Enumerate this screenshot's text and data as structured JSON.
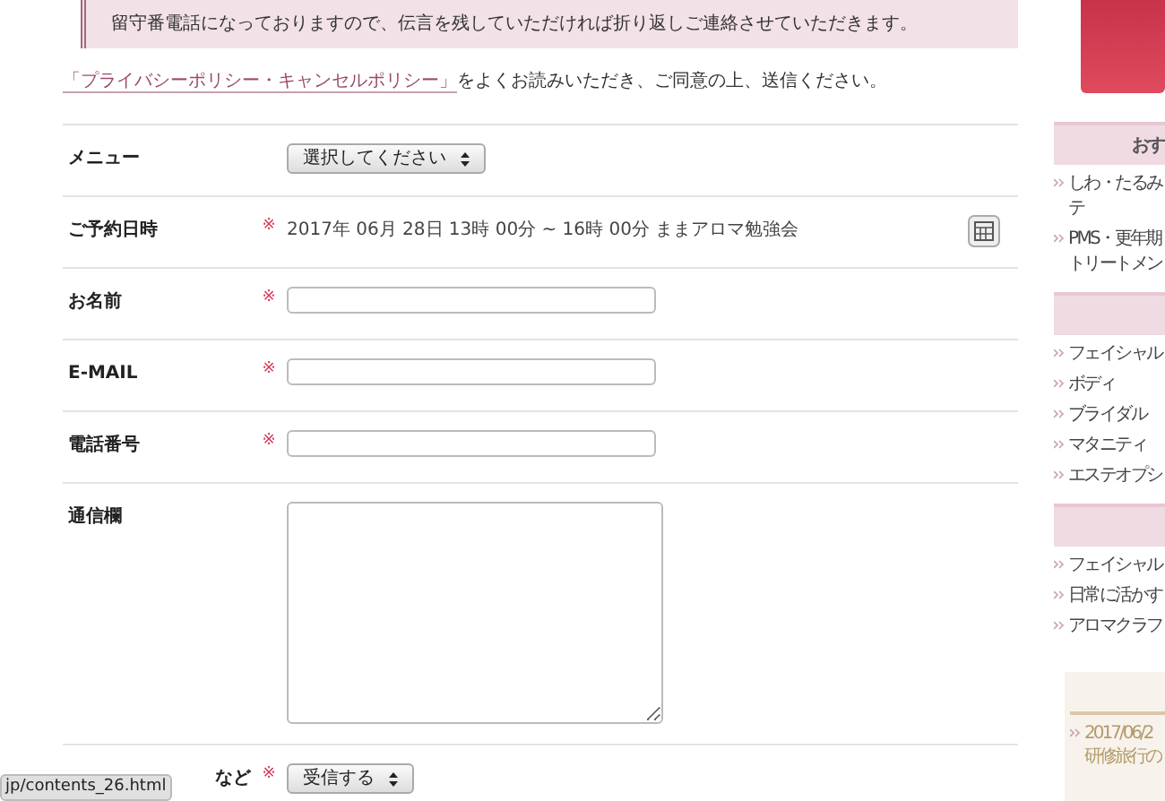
{
  "notice": {
    "text": "留守番電話になっておりますので、伝言を残していただければ折り返しご連絡させていただきます。"
  },
  "policy": {
    "link": "「プライバシーポリシー・キャンセルポリシー」",
    "text": "をよくお読みいただき、ご同意の上、送信ください。"
  },
  "form": {
    "rows": [
      {
        "kind": "select",
        "label": "メニュー",
        "required": false,
        "value": "選択してください"
      },
      {
        "kind": "date",
        "label": "ご予約日時",
        "required": true,
        "value": "2017年 06月 28日 13時 00分 ~ 16時 00分 ままアロマ勉強会"
      },
      {
        "kind": "input",
        "label": "お名前",
        "required": true
      },
      {
        "kind": "input",
        "label": "E-MAIL",
        "required": true
      },
      {
        "kind": "input",
        "label": "電話番号",
        "required": true
      },
      {
        "kind": "textarea",
        "label": "通信欄",
        "required": false
      },
      {
        "kind": "select",
        "label": "など",
        "required": true,
        "value": "受信する"
      }
    ],
    "required_mark": "※"
  },
  "status_url": "jp/contents_26.html",
  "sidebar": {
    "sections": [
      {
        "heading": "おす",
        "items": [
          [
            "しわ・たるみ",
            "テ"
          ],
          [
            "PMS・更年期",
            "トリートメン"
          ]
        ]
      },
      {
        "items": [
          [
            "フェイシャル"
          ],
          [
            "ボディ"
          ],
          [
            "ブライダル"
          ],
          [
            "マタニティ"
          ],
          [
            "エステオプシ"
          ]
        ]
      },
      {
        "items": [
          [
            "フェイシャル"
          ],
          [
            "日常に活かす"
          ],
          [
            "アロマクラフ"
          ]
        ]
      }
    ],
    "news": {
      "date": "2017/06/2",
      "text": "研修旅行の"
    }
  }
}
